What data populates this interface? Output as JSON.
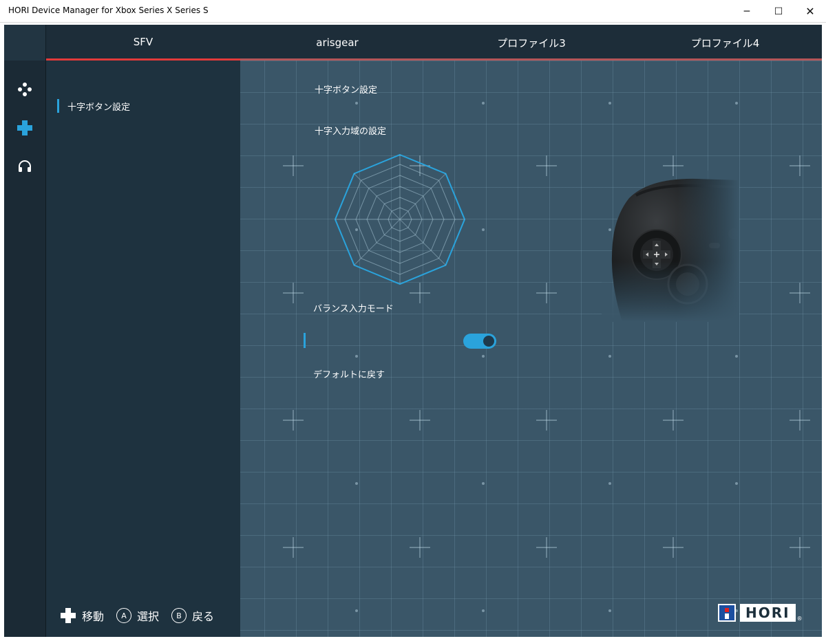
{
  "window": {
    "title": "HORI Device Manager for Xbox Series X Series S",
    "min_glyph": "─",
    "max_glyph": "☐",
    "close_glyph": "✕"
  },
  "tabs": [
    {
      "label": "SFV",
      "active": true
    },
    {
      "label": "arisgear",
      "active": false
    },
    {
      "label": "プロファイル3",
      "active": false
    },
    {
      "label": "プロファイル4",
      "active": false
    }
  ],
  "iconbar": [
    {
      "icon": "buttons-icon"
    },
    {
      "icon": "dpad-icon",
      "active": true
    },
    {
      "icon": "headset-icon"
    }
  ],
  "sidemenu": {
    "items": [
      {
        "label": "十字ボタン設定",
        "selected": true
      }
    ]
  },
  "content": {
    "section_title": "十字ボタン設定",
    "range_label": "十字入力域の設定",
    "balance_label": "バランス入力モード",
    "balance_on": true,
    "reset_label": "デフォルトに戻す"
  },
  "hints": {
    "move": "移動",
    "select_key": "A",
    "select": "選択",
    "back_key": "B",
    "back": "戻る"
  },
  "logo": {
    "text": "HORI",
    "reg": "®"
  },
  "colors": {
    "accent": "#2aa3dc",
    "active_tab": "#e23a3a",
    "background": "#1d313e",
    "grid": "#3a5668"
  }
}
